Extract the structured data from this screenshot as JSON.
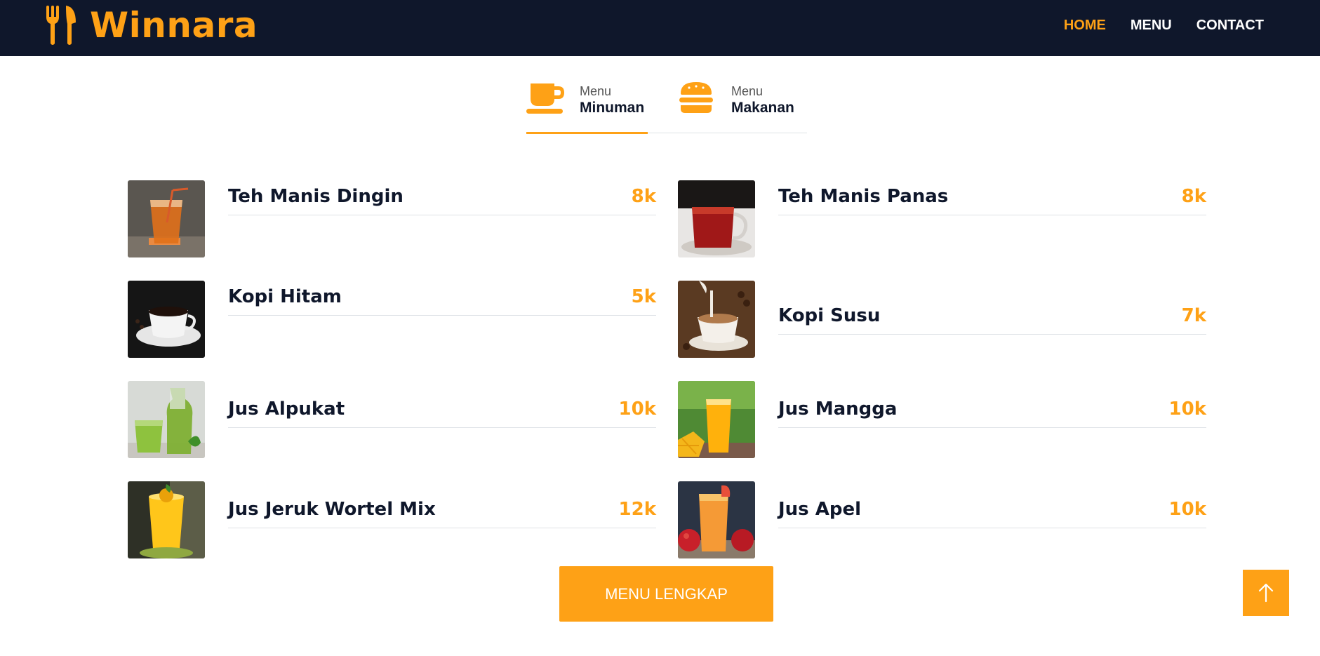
{
  "brand": {
    "name": "Winnara",
    "icon": "utensils-icon"
  },
  "nav": {
    "items": [
      {
        "label": "HOME",
        "active": true
      },
      {
        "label": "MENU",
        "active": false
      },
      {
        "label": "CONTACT",
        "active": false
      }
    ]
  },
  "tabs": [
    {
      "small": "Menu",
      "big": "Minuman",
      "icon": "coffee-cup-icon",
      "active": true
    },
    {
      "small": "Menu",
      "big": "Makanan",
      "icon": "hamburger-icon",
      "active": false
    }
  ],
  "menu": {
    "items": [
      {
        "name": "Teh Manis Dingin",
        "price": "8k",
        "image": "iced-tea-photo"
      },
      {
        "name": "Teh Manis Panas",
        "price": "8k",
        "image": "hot-tea-photo"
      },
      {
        "name": "Kopi Hitam",
        "price": "5k",
        "image": "black-coffee-photo"
      },
      {
        "name": "Kopi Susu",
        "price": "7k",
        "image": "milk-coffee-photo"
      },
      {
        "name": "Jus Alpukat",
        "price": "10k",
        "image": "avocado-juice-photo"
      },
      {
        "name": "Jus Mangga",
        "price": "10k",
        "image": "mango-juice-photo"
      },
      {
        "name": "Jus Jeruk Wortel Mix",
        "price": "12k",
        "image": "orange-carrot-juice-photo"
      },
      {
        "name": "Jus Apel",
        "price": "10k",
        "image": "apple-juice-photo"
      }
    ]
  },
  "buttons": {
    "full_menu": "MENU LENGKAP",
    "back_to_top_icon": "arrow-up-icon"
  },
  "colors": {
    "primary": "#fea116",
    "dark": "#0f172b"
  }
}
